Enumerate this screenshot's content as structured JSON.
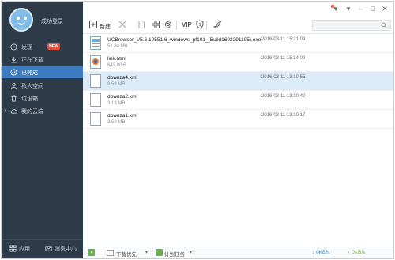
{
  "sidebar": {
    "username": "成功登录",
    "items": [
      {
        "label": "发现",
        "badge": "NEW",
        "icon": "compass-icon"
      },
      {
        "label": "正在下载",
        "icon": "download-icon"
      },
      {
        "label": "已完成",
        "icon": "check-circle-icon"
      },
      {
        "label": "私人空间",
        "icon": "person-icon"
      },
      {
        "label": "垃圾箱",
        "icon": "trash-icon"
      },
      {
        "label": "我的云端",
        "icon": "cloud-icon"
      }
    ],
    "bottom": {
      "apps_label": "应用",
      "messages_label": "消息中心"
    }
  },
  "toolbar": {
    "new_label": "新建",
    "vip_label": "VIP",
    "search_placeholder": ""
  },
  "files": [
    {
      "name": "UCBrowser_V5.6.10551.6_windows_pf101_(Build1602291105).exe",
      "size": "51.84 MB",
      "date": "2016-03-11 15:21:09",
      "icon": "exe-file-icon"
    },
    {
      "name": "link.html",
      "size": "643.00 B",
      "date": "2016-03-11 15:14:09",
      "icon": "html-file-icon"
    },
    {
      "name": "downza4.xml",
      "size": "8.53 MB",
      "date": "2016-03-11 13:10:55",
      "icon": "xml-file-icon",
      "selected": true
    },
    {
      "name": "downza2.xml",
      "size": "3.13 MB",
      "date": "2016-03-11 13:10:42",
      "icon": "xml-file-icon"
    },
    {
      "name": "downza1.xml",
      "size": "3.58 MB",
      "date": "2016-03-11 13:10:17",
      "icon": "xml-file-icon"
    }
  ],
  "status": {
    "download_option": "下载优先",
    "plan": "计划任务",
    "down_speed": "0KB/s",
    "up_speed": "0KB/s"
  },
  "colors": {
    "sidebar_bg": "#2e3b48",
    "active": "#3d7cc0",
    "selected_row": "#dcebf8"
  }
}
